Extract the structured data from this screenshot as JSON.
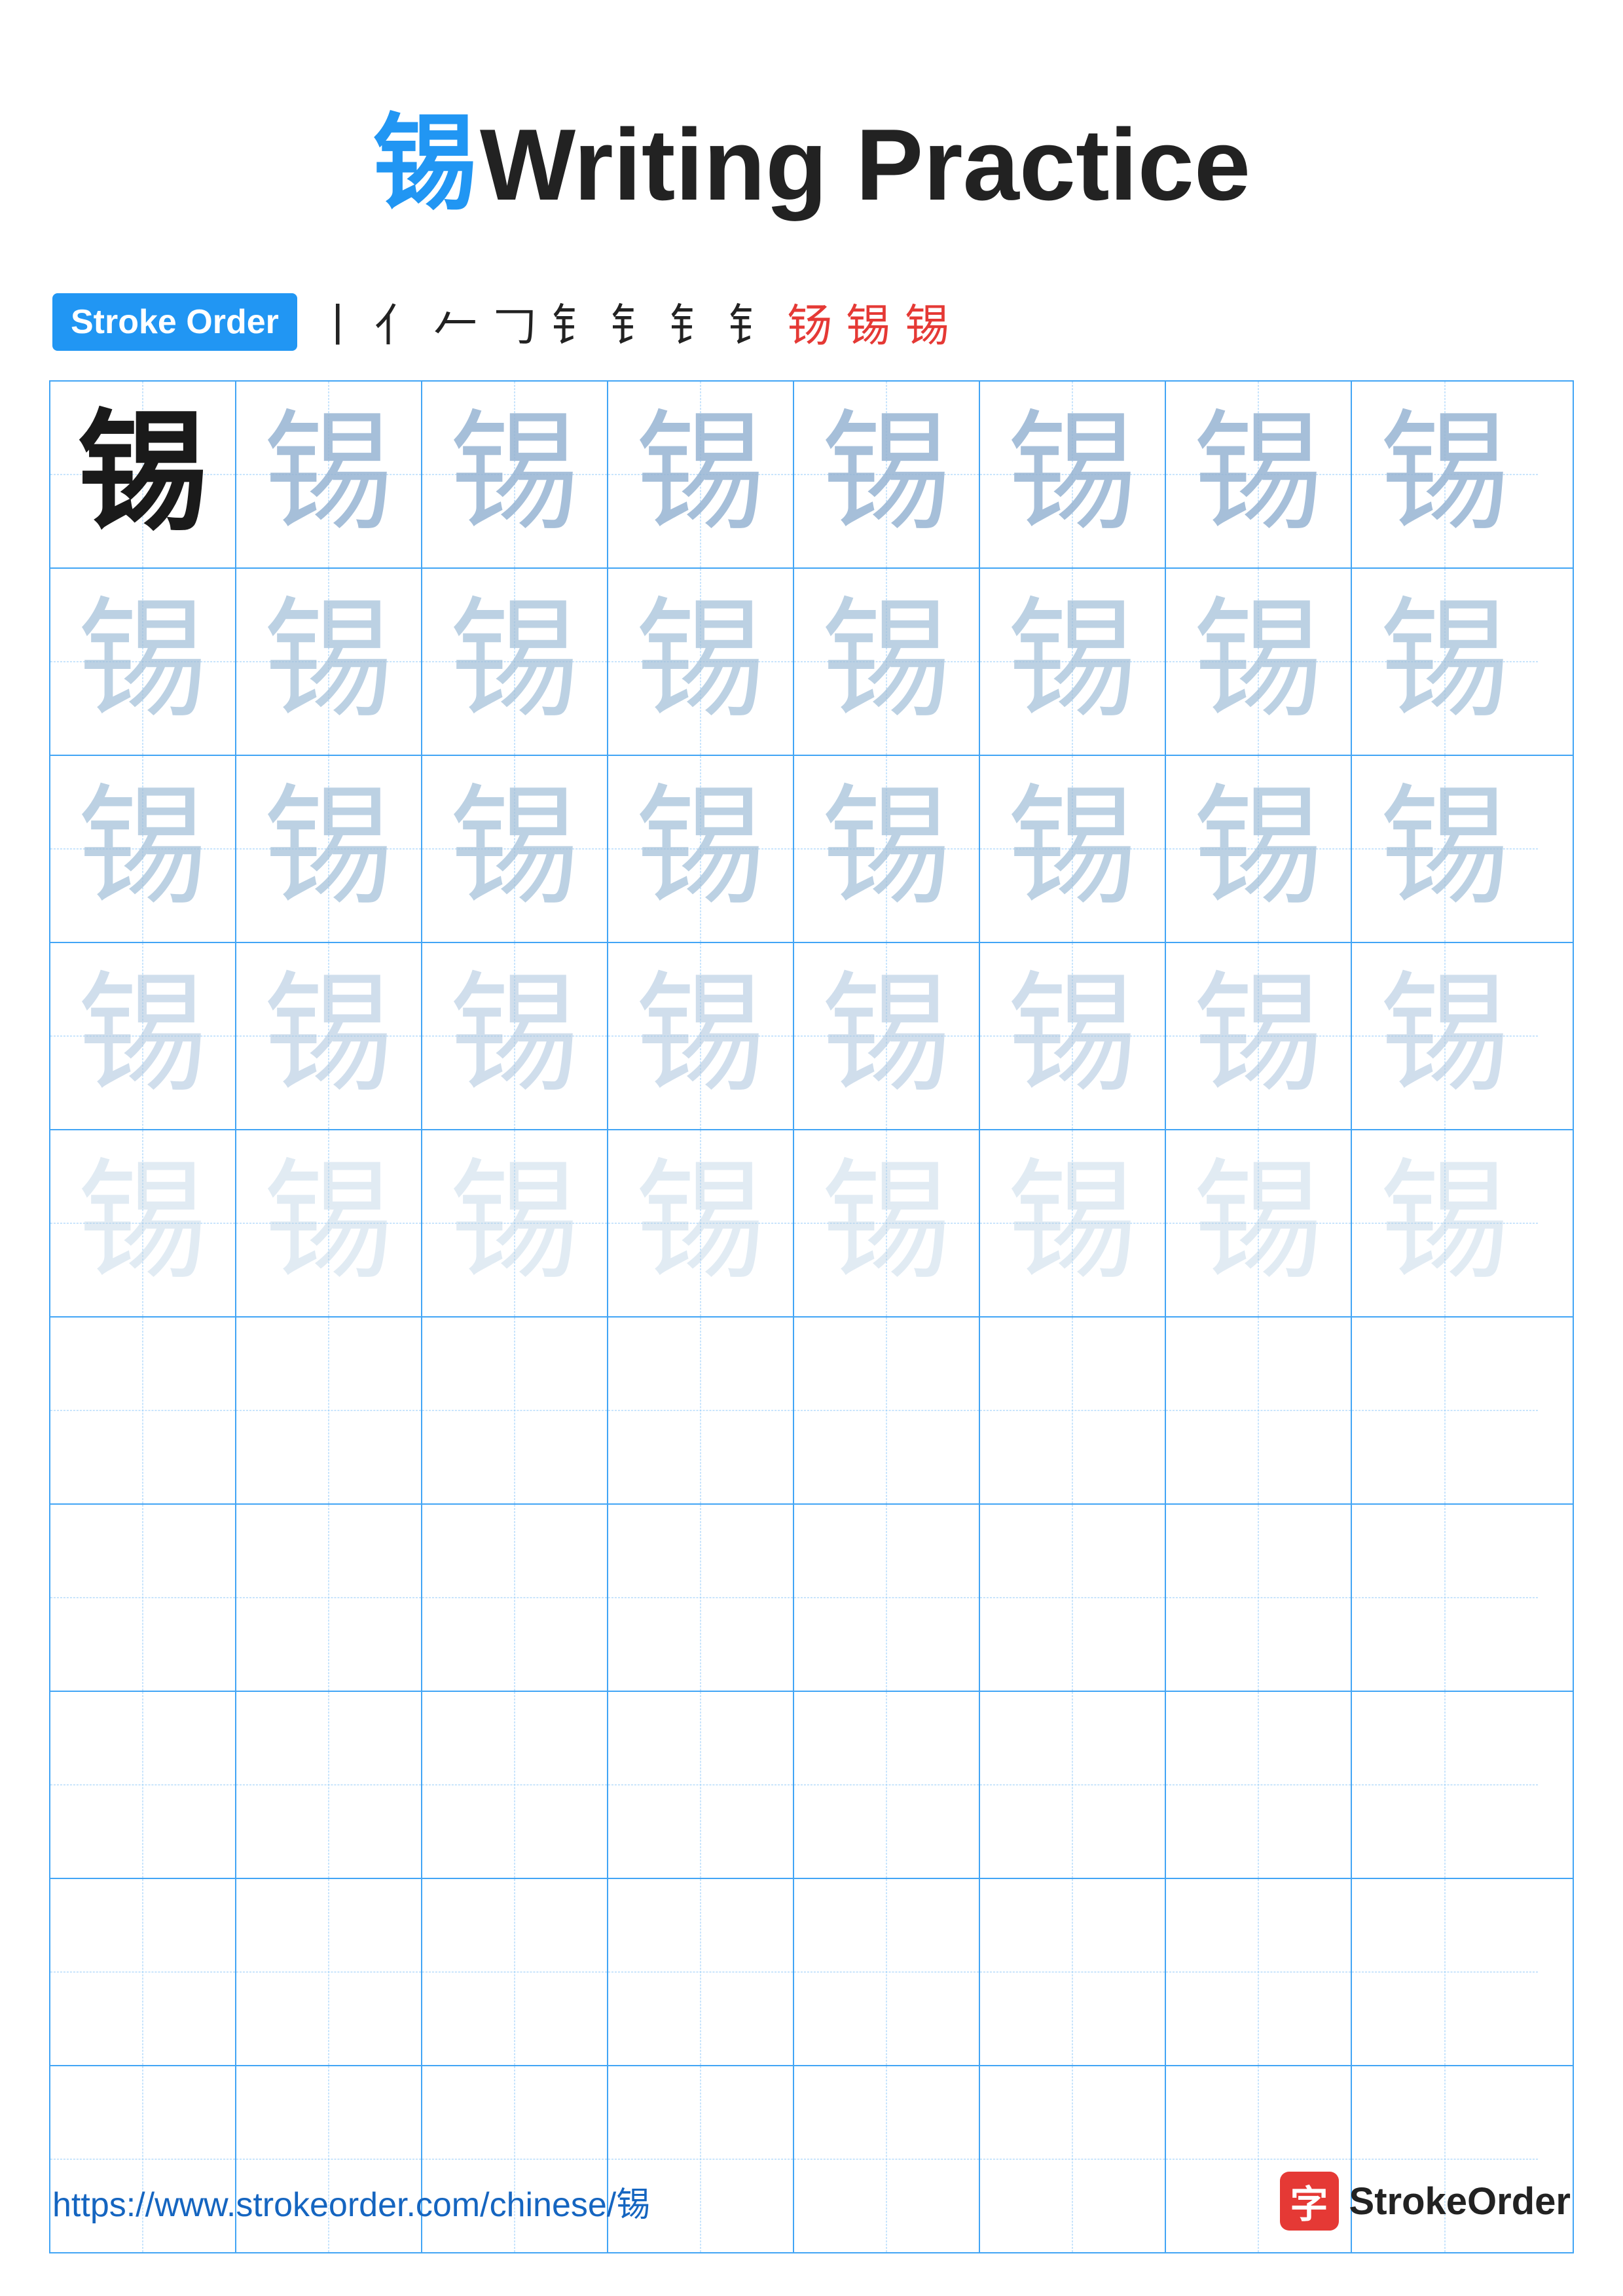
{
  "title": {
    "char": "锡",
    "text": "Writing Practice"
  },
  "stroke_order": {
    "badge_label": "Stroke Order",
    "strokes": [
      "丨",
      "亻",
      "𠂉",
      "𠃊",
      "钅",
      "钅",
      "钅",
      "钅",
      "钘",
      "钖",
      "锡"
    ]
  },
  "grid": {
    "char": "锡",
    "rows": 10,
    "cols": 8
  },
  "footer": {
    "url": "https://www.strokeorder.com/chinese/锡",
    "logo_text": "StrokeOrder",
    "logo_icon": "字"
  }
}
